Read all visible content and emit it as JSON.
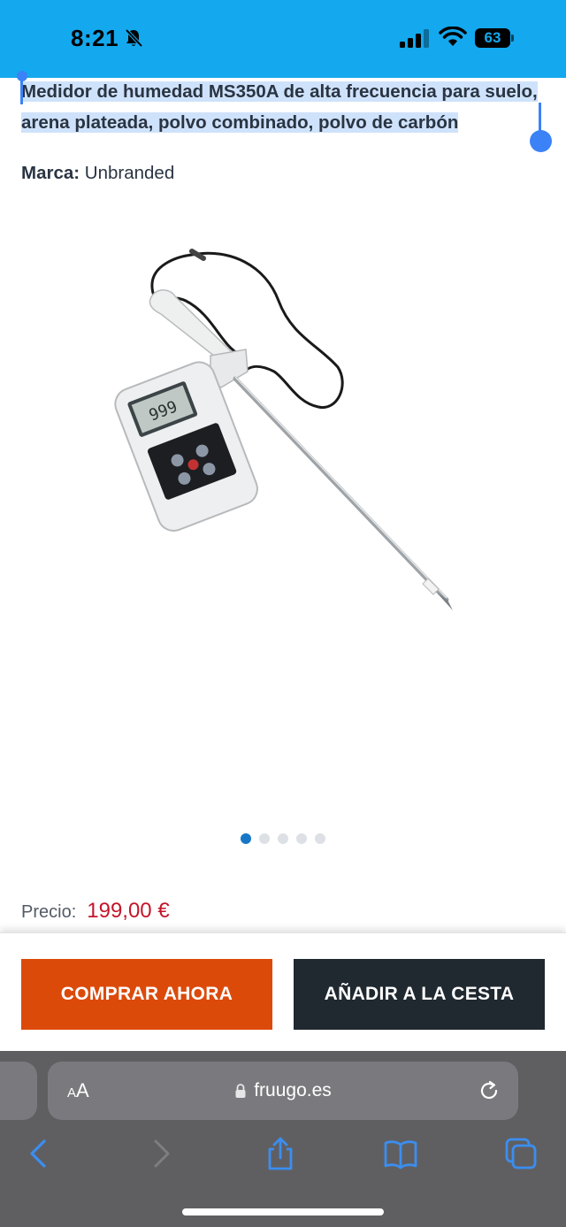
{
  "status_bar": {
    "time": "8:21",
    "battery": "63",
    "icons": [
      "bell-muted-icon",
      "signal-icon",
      "wifi-icon",
      "battery-icon"
    ]
  },
  "product": {
    "title": "Medidor de humedad MS350A de alta frecuencia para suelo, arena plateada, polvo combinado, polvo de carbón",
    "brand_label": "Marca:",
    "brand_value": "Unbranded",
    "display_reading": "999",
    "price_label": "Precio:",
    "price_value": "199,00 €",
    "image_count": 5,
    "active_image_index": 0
  },
  "actions": {
    "buy_now": "COMPRAR AHORA",
    "add_to_cart": "AÑADIR A LA CESTA"
  },
  "browser": {
    "aa_big": "A",
    "aa_small": "A",
    "url": "fruugo.es",
    "nav_icons": [
      "back-icon",
      "forward-icon",
      "share-icon",
      "bookmarks-icon",
      "tabs-icon"
    ]
  },
  "colors": {
    "status_bar": "#14a8ee",
    "buy_button": "#dc4a0a",
    "cart_button": "#202830",
    "price": "#c4162a",
    "selection": "#cfe2fb",
    "accent_dot": "#1677c8",
    "nav_icon": "#3b8ef0"
  }
}
